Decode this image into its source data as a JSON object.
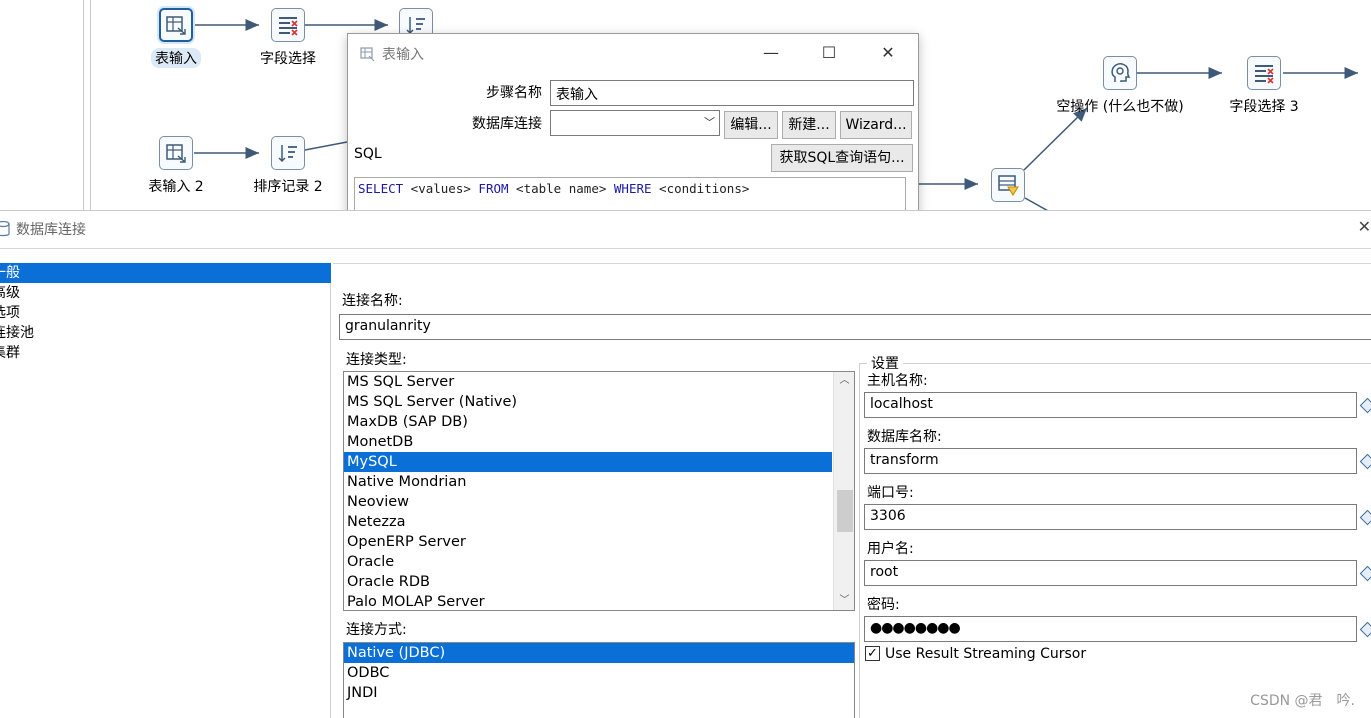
{
  "canvas": {
    "steps": [
      {
        "id": "table-input-1",
        "label": "表输入",
        "icon": "table-input-icon",
        "selected": true
      },
      {
        "id": "select-values-1",
        "label": "字段选择",
        "icon": "select-values-icon"
      },
      {
        "id": "sort-rows-1",
        "label": "",
        "icon": "sort-rows-icon"
      },
      {
        "id": "table-input-2",
        "label": "表输入 2",
        "icon": "table-input-icon"
      },
      {
        "id": "sort-rows-2",
        "label": "排序记录 2",
        "icon": "sort-rows-icon"
      },
      {
        "id": "merge-join",
        "label": "",
        "icon": "merge-join-icon"
      },
      {
        "id": "dummy",
        "label": "空操作 (什么也不做)",
        "icon": "dummy-icon"
      },
      {
        "id": "select-values-3",
        "label": "字段选择 3",
        "icon": "select-values-icon"
      }
    ]
  },
  "table_input_dialog": {
    "title": "表输入",
    "step_name_label": "步骤名称",
    "step_name_value": "表输入",
    "db_connection_label": "数据库连接",
    "db_connection_value": "",
    "edit_button": "编辑...",
    "new_button": "新建...",
    "wizard_button": "Wizard...",
    "sql_label": "SQL",
    "get_sql_button": "获取SQL查询语句...",
    "sql_tokens": [
      {
        "text": "SELECT",
        "kind": "kw"
      },
      {
        "text": " <values> ",
        "kind": "tx"
      },
      {
        "text": "FROM",
        "kind": "kw"
      },
      {
        "text": " <table name> ",
        "kind": "tx"
      },
      {
        "text": "WHERE",
        "kind": "kw"
      },
      {
        "text": " <conditions>",
        "kind": "tx"
      }
    ]
  },
  "db_dialog": {
    "title": "数据库连接",
    "nav_items": [
      {
        "label": "一般",
        "selected": true
      },
      {
        "label": "高级",
        "selected": false
      },
      {
        "label": "选项",
        "selected": false
      },
      {
        "label": "连接池",
        "selected": false
      },
      {
        "label": "集群",
        "selected": false
      }
    ],
    "connection_name_label": "连接名称:",
    "connection_name_value": "granulanrity",
    "connection_type_label": "连接类型:",
    "connection_types": [
      {
        "label": "MS SQL Server",
        "selected": false
      },
      {
        "label": "MS SQL Server (Native)",
        "selected": false
      },
      {
        "label": "MaxDB (SAP DB)",
        "selected": false
      },
      {
        "label": "MonetDB",
        "selected": false
      },
      {
        "label": "MySQL",
        "selected": true
      },
      {
        "label": "Native Mondrian",
        "selected": false
      },
      {
        "label": "Neoview",
        "selected": false
      },
      {
        "label": "Netezza",
        "selected": false
      },
      {
        "label": "OpenERP Server",
        "selected": false
      },
      {
        "label": "Oracle",
        "selected": false
      },
      {
        "label": "Oracle RDB",
        "selected": false
      },
      {
        "label": "Palo MOLAP Server",
        "selected": false
      }
    ],
    "access_label": "连接方式:",
    "access_methods": [
      {
        "label": "Native (JDBC)",
        "selected": true
      },
      {
        "label": "ODBC",
        "selected": false
      },
      {
        "label": "JNDI",
        "selected": false
      }
    ],
    "settings": {
      "title": "设置",
      "host_label": "主机名称:",
      "host_value": "localhost",
      "database_label": "数据库名称:",
      "database_value": "transform",
      "port_label": "端口号:",
      "port_value": "3306",
      "user_label": "用户名:",
      "user_value": "root",
      "password_label": "密码:",
      "password_value": "●●●●●●●●",
      "streaming_label": "Use Result Streaming Cursor",
      "streaming_checked": true,
      "check_mark": "✓"
    }
  },
  "watermark": "CSDN @君　吟."
}
